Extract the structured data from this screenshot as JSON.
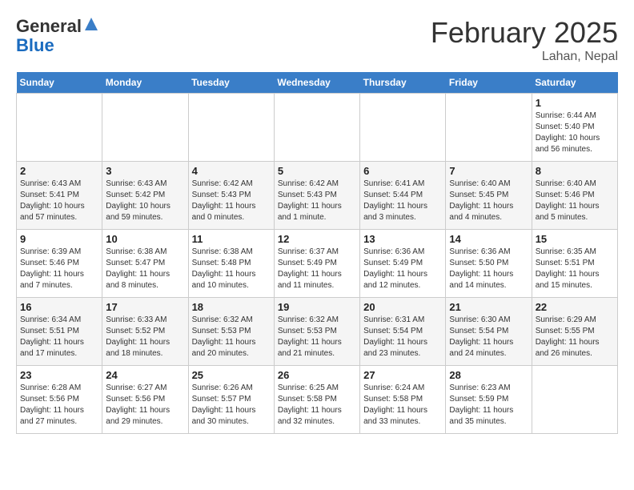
{
  "header": {
    "logo_general": "General",
    "logo_blue": "Blue",
    "month_year": "February 2025",
    "location": "Lahan, Nepal"
  },
  "weekdays": [
    "Sunday",
    "Monday",
    "Tuesday",
    "Wednesday",
    "Thursday",
    "Friday",
    "Saturday"
  ],
  "weeks": [
    [
      {
        "day": "",
        "info": ""
      },
      {
        "day": "",
        "info": ""
      },
      {
        "day": "",
        "info": ""
      },
      {
        "day": "",
        "info": ""
      },
      {
        "day": "",
        "info": ""
      },
      {
        "day": "",
        "info": ""
      },
      {
        "day": "1",
        "info": "Sunrise: 6:44 AM\nSunset: 5:40 PM\nDaylight: 10 hours and 56 minutes."
      }
    ],
    [
      {
        "day": "2",
        "info": "Sunrise: 6:43 AM\nSunset: 5:41 PM\nDaylight: 10 hours and 57 minutes."
      },
      {
        "day": "3",
        "info": "Sunrise: 6:43 AM\nSunset: 5:42 PM\nDaylight: 10 hours and 59 minutes."
      },
      {
        "day": "4",
        "info": "Sunrise: 6:42 AM\nSunset: 5:43 PM\nDaylight: 11 hours and 0 minutes."
      },
      {
        "day": "5",
        "info": "Sunrise: 6:42 AM\nSunset: 5:43 PM\nDaylight: 11 hours and 1 minute."
      },
      {
        "day": "6",
        "info": "Sunrise: 6:41 AM\nSunset: 5:44 PM\nDaylight: 11 hours and 3 minutes."
      },
      {
        "day": "7",
        "info": "Sunrise: 6:40 AM\nSunset: 5:45 PM\nDaylight: 11 hours and 4 minutes."
      },
      {
        "day": "8",
        "info": "Sunrise: 6:40 AM\nSunset: 5:46 PM\nDaylight: 11 hours and 5 minutes."
      }
    ],
    [
      {
        "day": "9",
        "info": "Sunrise: 6:39 AM\nSunset: 5:46 PM\nDaylight: 11 hours and 7 minutes."
      },
      {
        "day": "10",
        "info": "Sunrise: 6:38 AM\nSunset: 5:47 PM\nDaylight: 11 hours and 8 minutes."
      },
      {
        "day": "11",
        "info": "Sunrise: 6:38 AM\nSunset: 5:48 PM\nDaylight: 11 hours and 10 minutes."
      },
      {
        "day": "12",
        "info": "Sunrise: 6:37 AM\nSunset: 5:49 PM\nDaylight: 11 hours and 11 minutes."
      },
      {
        "day": "13",
        "info": "Sunrise: 6:36 AM\nSunset: 5:49 PM\nDaylight: 11 hours and 12 minutes."
      },
      {
        "day": "14",
        "info": "Sunrise: 6:36 AM\nSunset: 5:50 PM\nDaylight: 11 hours and 14 minutes."
      },
      {
        "day": "15",
        "info": "Sunrise: 6:35 AM\nSunset: 5:51 PM\nDaylight: 11 hours and 15 minutes."
      }
    ],
    [
      {
        "day": "16",
        "info": "Sunrise: 6:34 AM\nSunset: 5:51 PM\nDaylight: 11 hours and 17 minutes."
      },
      {
        "day": "17",
        "info": "Sunrise: 6:33 AM\nSunset: 5:52 PM\nDaylight: 11 hours and 18 minutes."
      },
      {
        "day": "18",
        "info": "Sunrise: 6:32 AM\nSunset: 5:53 PM\nDaylight: 11 hours and 20 minutes."
      },
      {
        "day": "19",
        "info": "Sunrise: 6:32 AM\nSunset: 5:53 PM\nDaylight: 11 hours and 21 minutes."
      },
      {
        "day": "20",
        "info": "Sunrise: 6:31 AM\nSunset: 5:54 PM\nDaylight: 11 hours and 23 minutes."
      },
      {
        "day": "21",
        "info": "Sunrise: 6:30 AM\nSunset: 5:54 PM\nDaylight: 11 hours and 24 minutes."
      },
      {
        "day": "22",
        "info": "Sunrise: 6:29 AM\nSunset: 5:55 PM\nDaylight: 11 hours and 26 minutes."
      }
    ],
    [
      {
        "day": "23",
        "info": "Sunrise: 6:28 AM\nSunset: 5:56 PM\nDaylight: 11 hours and 27 minutes."
      },
      {
        "day": "24",
        "info": "Sunrise: 6:27 AM\nSunset: 5:56 PM\nDaylight: 11 hours and 29 minutes."
      },
      {
        "day": "25",
        "info": "Sunrise: 6:26 AM\nSunset: 5:57 PM\nDaylight: 11 hours and 30 minutes."
      },
      {
        "day": "26",
        "info": "Sunrise: 6:25 AM\nSunset: 5:58 PM\nDaylight: 11 hours and 32 minutes."
      },
      {
        "day": "27",
        "info": "Sunrise: 6:24 AM\nSunset: 5:58 PM\nDaylight: 11 hours and 33 minutes."
      },
      {
        "day": "28",
        "info": "Sunrise: 6:23 AM\nSunset: 5:59 PM\nDaylight: 11 hours and 35 minutes."
      },
      {
        "day": "",
        "info": ""
      }
    ]
  ]
}
